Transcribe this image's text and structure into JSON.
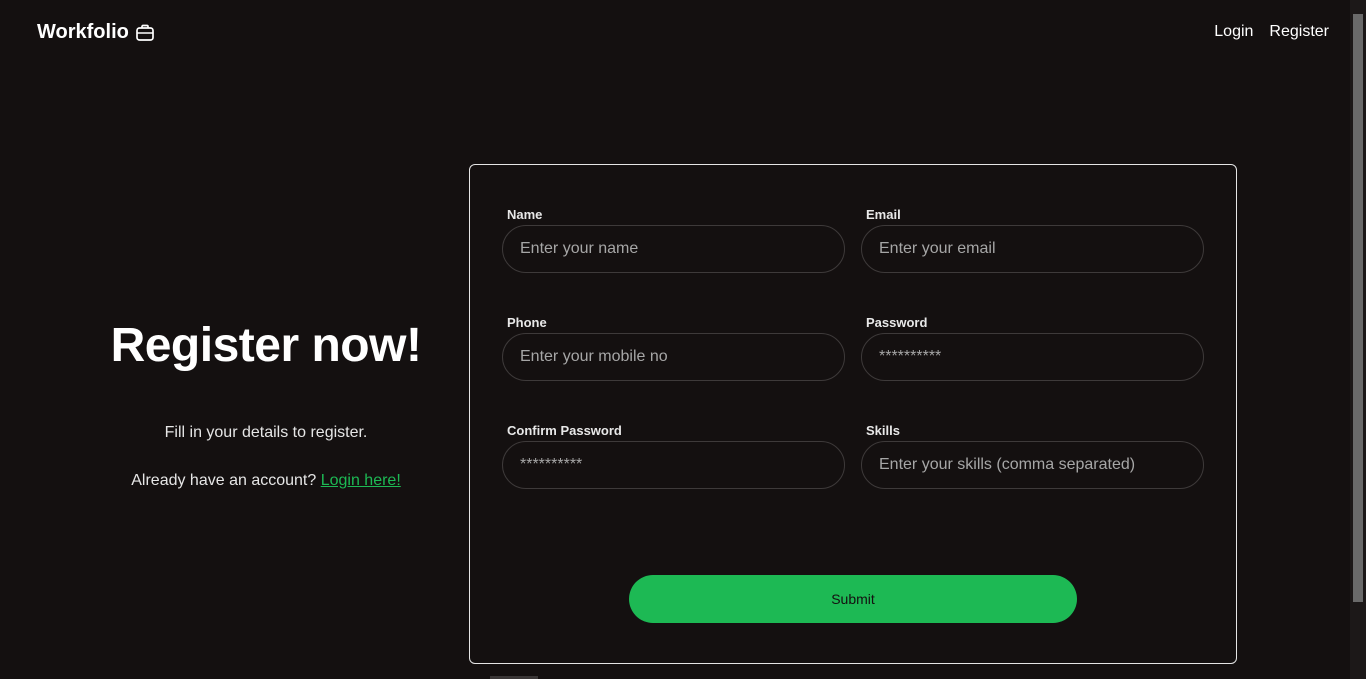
{
  "brand": {
    "name": "Workfolio",
    "icon": "briefcase-icon"
  },
  "nav": {
    "login": "Login",
    "register": "Register"
  },
  "hero": {
    "title": "Register now!",
    "subtitle": "Fill in your details to register.",
    "login_prompt": "Already have an account?",
    "login_link": "Login here!"
  },
  "form": {
    "name": {
      "label": "Name",
      "placeholder": "Enter your name"
    },
    "email": {
      "label": "Email",
      "placeholder": "Enter your email"
    },
    "phone": {
      "label": "Phone",
      "placeholder": "Enter your mobile no"
    },
    "password": {
      "label": "Password",
      "placeholder": "**********"
    },
    "confirm_password": {
      "label": "Confirm Password",
      "placeholder": "**********"
    },
    "skills": {
      "label": "Skills",
      "placeholder": "Enter your skills (comma separated)"
    },
    "submit_label": "Submit"
  },
  "colors": {
    "background": "#141010",
    "accent": "#1db954",
    "card_border": "#e5e5e5"
  }
}
